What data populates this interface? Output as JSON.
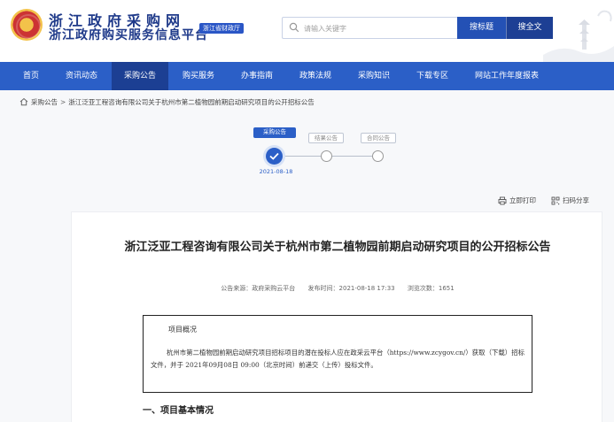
{
  "header": {
    "site_title": "浙江政府采购网",
    "site_subtitle": "浙江政府购买服务信息平台",
    "dept_badge": "浙江省财政厅",
    "search_placeholder": "请输入关键字",
    "search_title_button": "搜标题",
    "search_full_button": "搜全文"
  },
  "nav": {
    "items": [
      "首页",
      "资讯动态",
      "采购公告",
      "购买服务",
      "办事指南",
      "政策法规",
      "采购知识",
      "下载专区",
      "网站工作年度报表"
    ],
    "active_index": 2
  },
  "breadcrumb": {
    "root": "采购公告",
    "separator": ">",
    "current": "浙江泛亚工程咨询有限公司关于杭州市第二植物园前期启动研究项目的公开招标公告"
  },
  "progress": {
    "steps": [
      "采购公告",
      "结果公告",
      "合同公告"
    ],
    "current_step": 0,
    "current_date": "2021-08-18"
  },
  "tools": {
    "print_label": "立即打印",
    "share_label": "扫码分享"
  },
  "article": {
    "title": "浙江泛亚工程咨询有限公司关于杭州市第二植物园前期启动研究项目的公开招标公告",
    "source_label": "公告来源：政府采购云平台",
    "publish_label": "发布时间：2021-08-18 17:33",
    "views_label": "浏览次数：1651",
    "summary_heading": "项目概况",
    "summary_text": "杭州市第二植物园前期启动研究项目招标项目的潜在投标人应在政采云平台（https://www.zcygov.cn/）获取（下载）招标文件，并于 2021年09月08日 09:00（北京时间）前递交（上传）投标文件。",
    "section_heading": "一、项目基本情况"
  },
  "colors": {
    "primary": "#2b5fc7",
    "nav_active": "#1c3f93",
    "title_blue": "#1f3a8a"
  }
}
